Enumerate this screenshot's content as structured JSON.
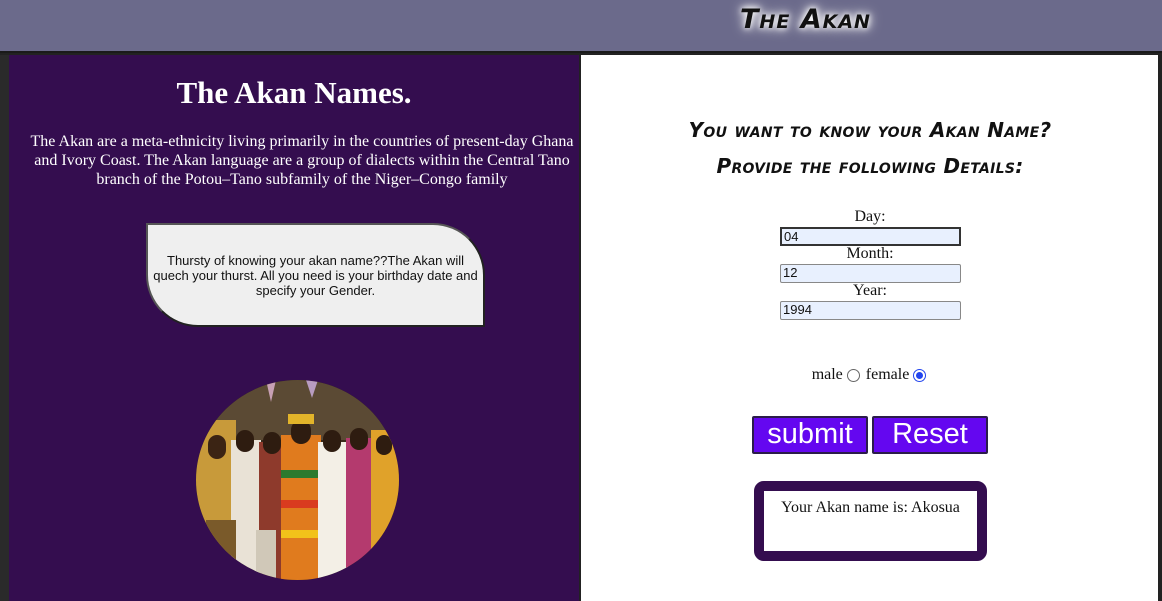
{
  "header": {
    "brand": "The Akan"
  },
  "intro": {
    "title": "The Akan Names.",
    "description": "The Akan are a meta-ethnicity living primarily in the countries of present-day Ghana and Ivory Coast. The Akan language are a group of dialects within the Central Tano branch of the Potou–Tano subfamily of the Niger–Congo family",
    "bubble_text": "Thursty of knowing your akan name??The Akan will quech your thurst. All you need is your birthday date and specify your Gender.",
    "photo_icon": "group-photo-icon"
  },
  "form": {
    "heading_line1": "You want to know your Akan Name?",
    "heading_line2": "Provide the following Details:",
    "day_label": "Day:",
    "day_value": "04",
    "month_label": "Month:",
    "month_value": "12",
    "year_label": "Year:",
    "year_value": "1994",
    "gender_male": "male",
    "gender_female": "female",
    "selected_gender": "female",
    "submit_label": "submit",
    "reset_label": "Reset"
  },
  "result": {
    "text": "Your Akan name is: Akosua"
  },
  "colors": {
    "header_bg": "#6b6a8b",
    "left_bg": "#340d4f",
    "button_bg": "#6407f0",
    "input_bg": "#e8f0fe",
    "radio_checked": "#2244ee"
  }
}
